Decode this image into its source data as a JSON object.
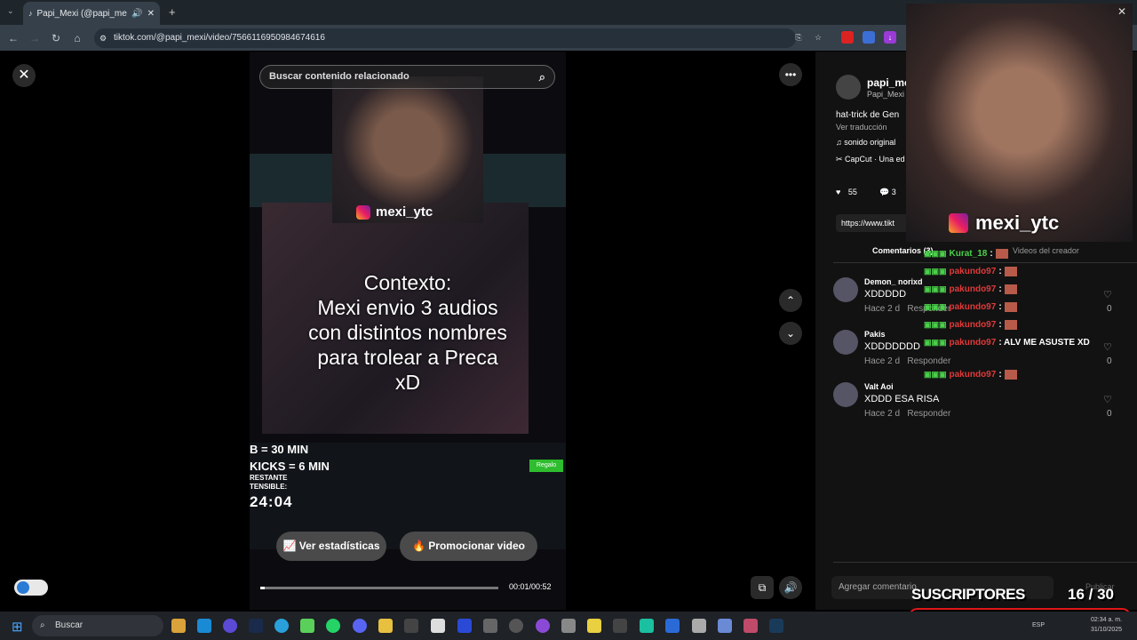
{
  "browser": {
    "tab_title": "Papi_Mexi (@papi_mexi) | TikTok",
    "url": "tiktok.com/@papi_mexi/video/7566116950984674616"
  },
  "video": {
    "search_placeholder": "Buscar contenido relacionado",
    "ig_handle": "mexi_ytc",
    "caption": "Contexto:\nMexi envio 3 audios\ncon distintos nombres\npara trolear a Preca\nxD",
    "stream_line1": "B = 30 MIN",
    "stream_line2": "KICKS = 6 MIN",
    "stream_line3": "RESTANTE",
    "stream_line4": "TENSIBLE:",
    "timer": "24:04",
    "gift_label": "Regalo",
    "stats_button": "Ver estadísticas",
    "promote_button": "Promocionar video",
    "time": "00:01/00:52",
    "progress": 0.02
  },
  "panel": {
    "author_name": "papi_me",
    "author_sub": "Papi_Mexi",
    "desc": "hat-trick de Gen",
    "translate": "Ver traducción",
    "sound": "sonido original",
    "capcut": "CapCut · Una ed",
    "likes": "55",
    "comments_count": "3",
    "link": "https://www.tikt",
    "tab_comments": "Comentarios (3)",
    "tab_creator": "Videos del creador",
    "add_comment": "Agregar comentario",
    "publish": "Publicar",
    "comments": [
      {
        "user": "Demon_ norixd",
        "text": "XDDDDD",
        "meta": "Hace 2 d",
        "reply": "Responder",
        "likes": "0"
      },
      {
        "user": "Pakis",
        "text": "XDDDDDDD",
        "meta": "Hace 2 d",
        "reply": "Responder",
        "likes": "0"
      },
      {
        "user": "Valt Aoi",
        "text": "XDDD ESA RISA",
        "meta": "Hace 2 d",
        "reply": "Responder",
        "likes": "0"
      }
    ]
  },
  "overlay": {
    "ig_handle": "mexi_ytc",
    "chat": [
      {
        "user": "Kurat_18",
        "msg": ":"
      },
      {
        "user": "pakundo97",
        "msg": ":"
      },
      {
        "user": "pakundo97",
        "msg": ":"
      },
      {
        "user": "pakundo97",
        "msg": ":"
      },
      {
        "user": "pakundo97",
        "msg": ":"
      },
      {
        "user": "pakundo97",
        "msg": ": ALV ME ASUSTE XD"
      },
      {
        "user": "pakundo97",
        "msg": ":"
      }
    ],
    "subs_label": "SUSCRIPTORES",
    "subs_count": "16  / 30",
    "subs_fraction": 0.53
  },
  "taskbar": {
    "search": "Buscar",
    "lang": "ESP",
    "time": "02:34 a. m.",
    "date": "31/10/2025"
  },
  "colors": {
    "accent_red": "#e01818",
    "chat_green": "#4ad04a",
    "chat_red": "#e03a3a"
  }
}
